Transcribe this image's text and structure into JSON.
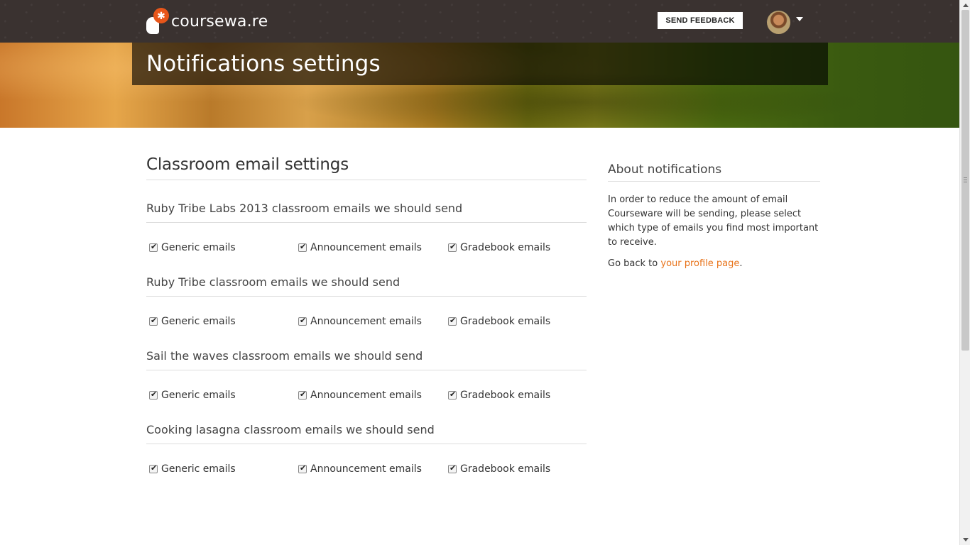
{
  "header": {
    "logo_text": "coursewa.re",
    "feedback_label": "SEND FEEDBACK"
  },
  "hero": {
    "title": "Notifications settings"
  },
  "main": {
    "section_title": "Classroom email settings",
    "classrooms": [
      {
        "title": "Ruby Tribe Labs 2013 classroom emails we should send",
        "options": [
          {
            "label": "Generic emails",
            "checked": true
          },
          {
            "label": "Announcement emails",
            "checked": true
          },
          {
            "label": "Gradebook emails",
            "checked": true
          }
        ]
      },
      {
        "title": "Ruby Tribe classroom emails we should send",
        "options": [
          {
            "label": "Generic emails",
            "checked": true
          },
          {
            "label": "Announcement emails",
            "checked": true
          },
          {
            "label": "Gradebook emails",
            "checked": true
          }
        ]
      },
      {
        "title": "Sail the waves classroom emails we should send",
        "options": [
          {
            "label": "Generic emails",
            "checked": true
          },
          {
            "label": "Announcement emails",
            "checked": true
          },
          {
            "label": "Gradebook emails",
            "checked": true
          }
        ]
      },
      {
        "title": "Cooking lasagna classroom emails we should send",
        "options": [
          {
            "label": "Generic emails",
            "checked": true
          },
          {
            "label": "Announcement emails",
            "checked": true
          },
          {
            "label": "Gradebook emails",
            "checked": true
          }
        ]
      }
    ]
  },
  "sidebar": {
    "title": "About notifications",
    "text": "In order to reduce the amount of email Courseware will be sending, please select which type of emails you find most important to receive.",
    "back_prefix": "Go back to ",
    "back_link": "your profile page",
    "back_suffix": "."
  },
  "colors": {
    "topbar": "#3a3230",
    "accent": "#e8561a",
    "link": "#e8731a"
  }
}
